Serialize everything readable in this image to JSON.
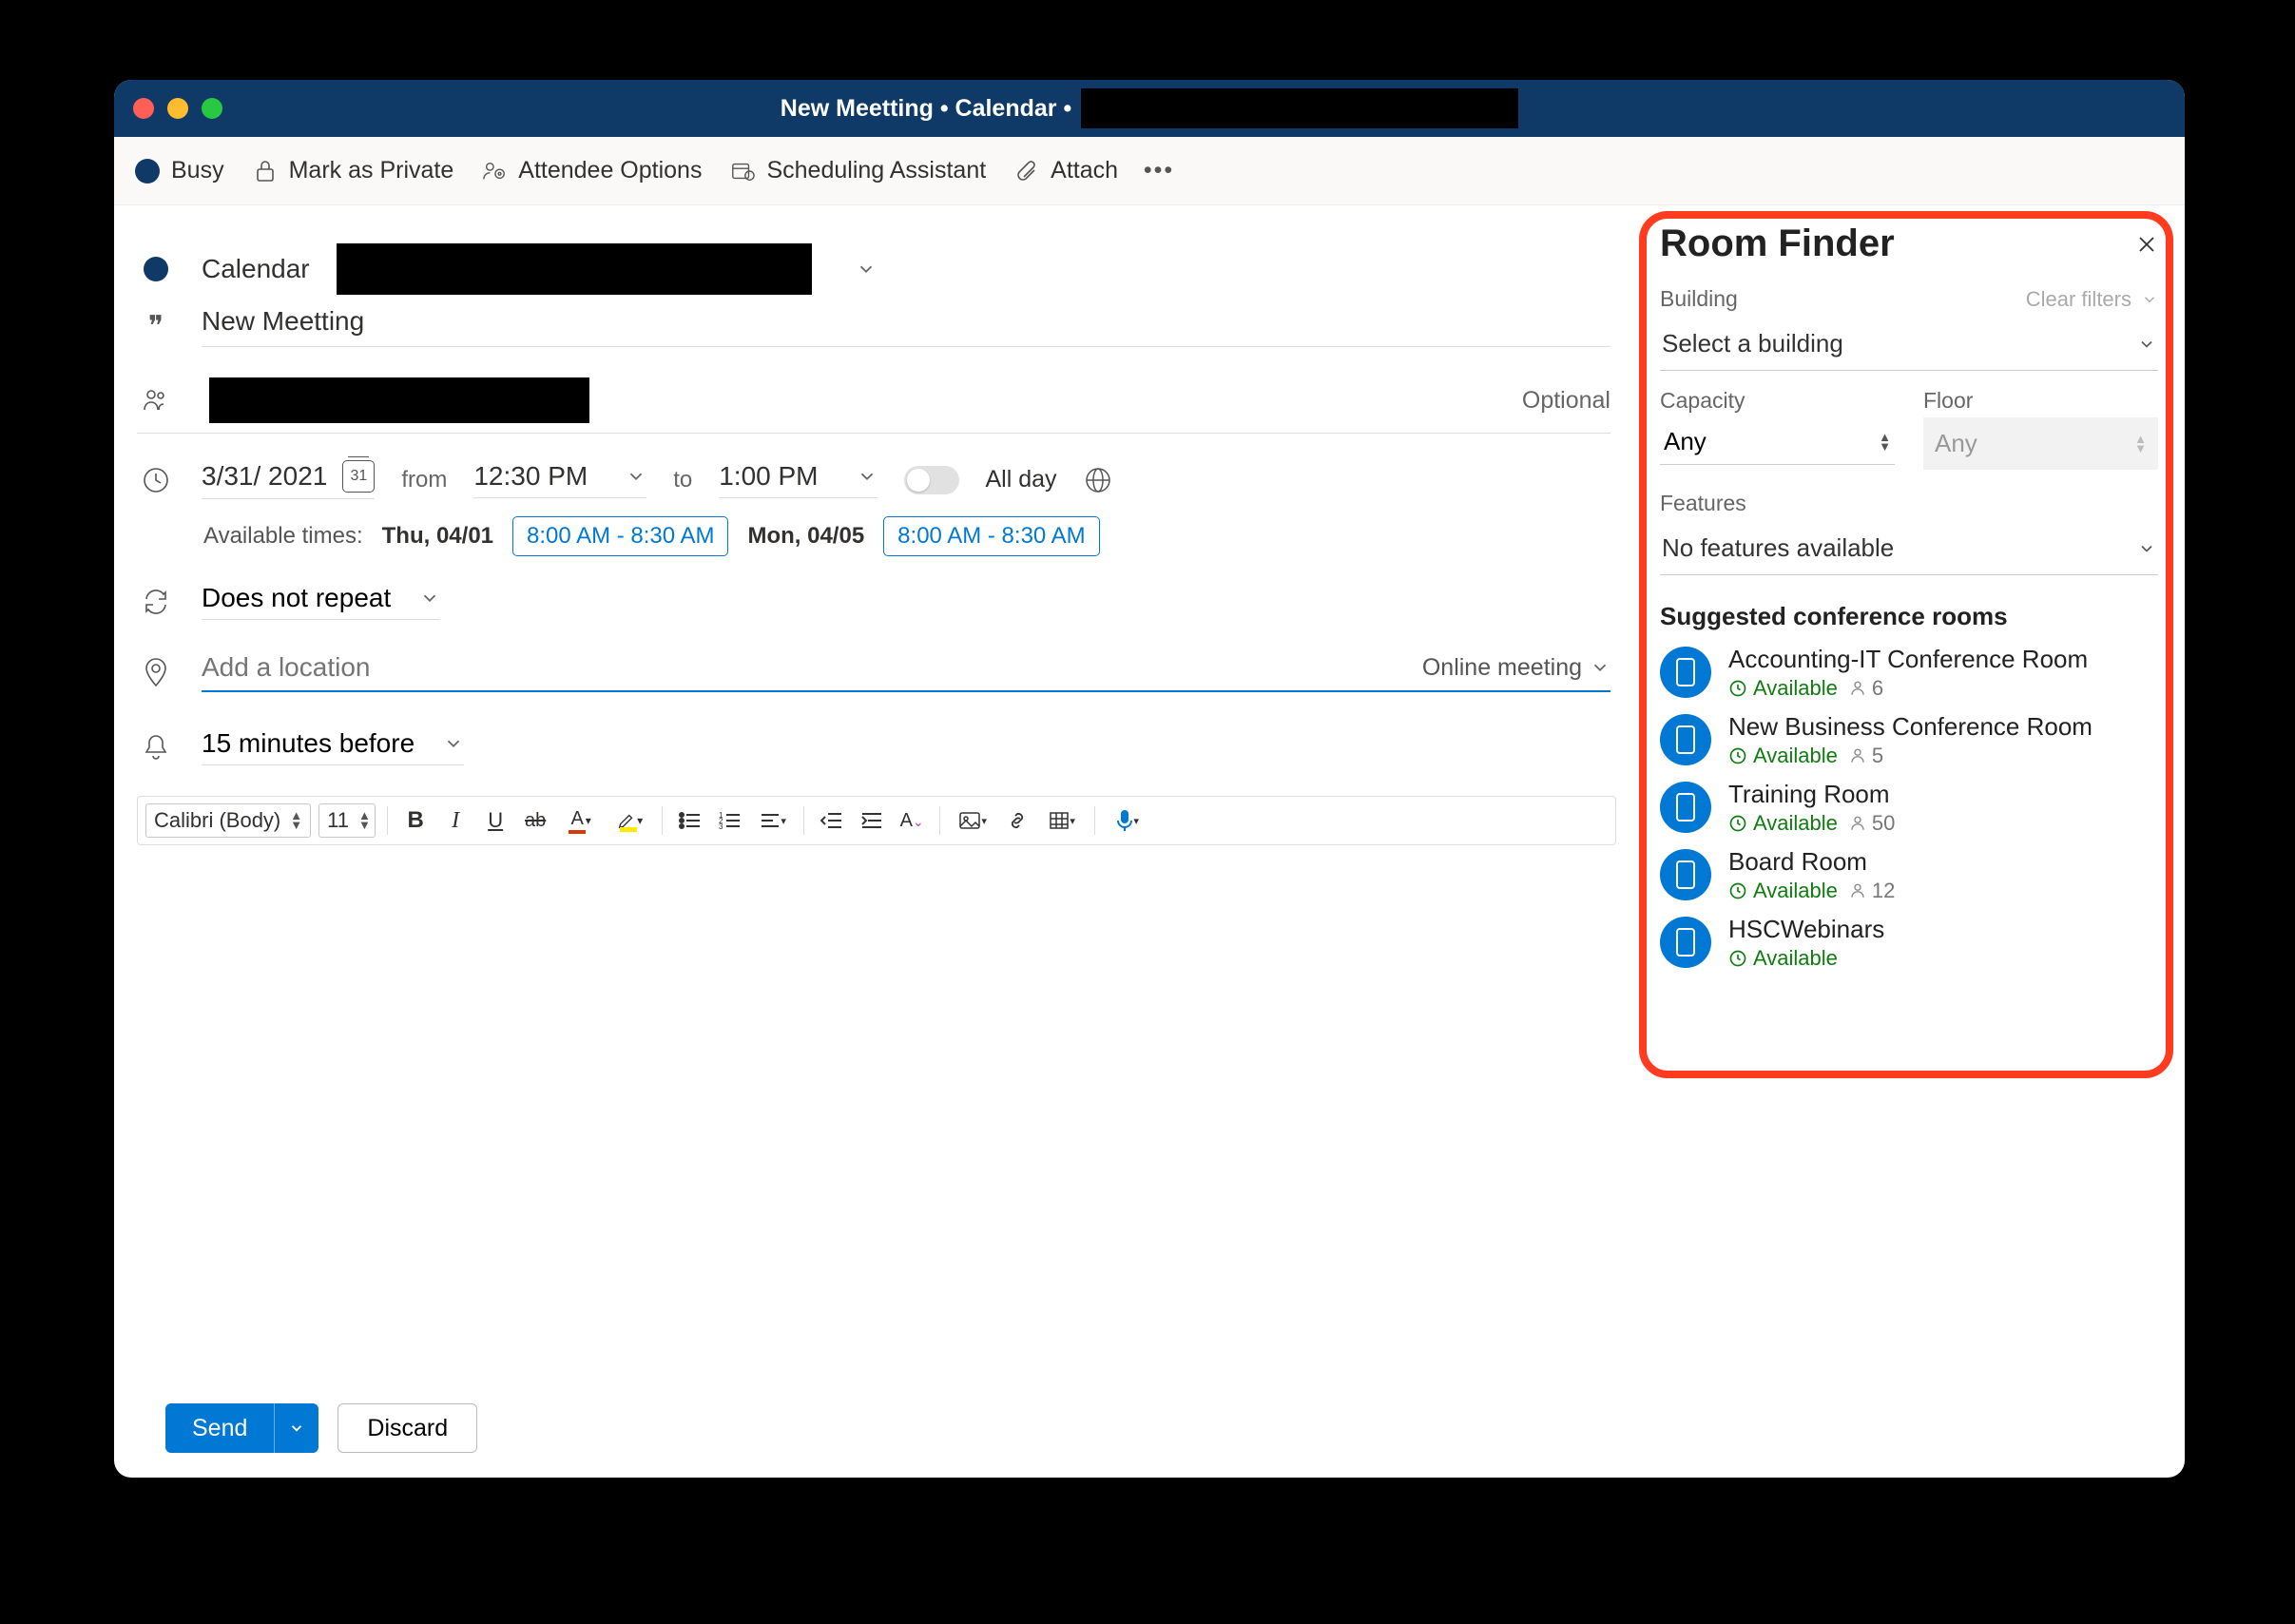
{
  "window": {
    "title_prefix": "New Meetting • Calendar •"
  },
  "ribbon": {
    "busy": "Busy",
    "private": "Mark as Private",
    "attendee_options": "Attendee Options",
    "scheduling_assistant": "Scheduling Assistant",
    "attach": "Attach"
  },
  "form": {
    "calendar_label": "Calendar",
    "title_value": "New Meetting",
    "optional_label": "Optional",
    "date": "3/31/ 2021",
    "from_label": "from",
    "start_time": "12:30 PM",
    "to_label": "to",
    "end_time": "1:00 PM",
    "all_day_label": "All day",
    "available_label": "Available times:",
    "avail_1_day": "Thu, 04/01",
    "avail_1_slot": "8:00 AM - 8:30 AM",
    "avail_2_day": "Mon, 04/05",
    "avail_2_slot": "8:00 AM - 8:30 AM",
    "repeat": "Does not repeat",
    "location_placeholder": "Add a location",
    "online_meeting": "Online meeting",
    "reminder": "15 minutes before"
  },
  "editor": {
    "font_name": "Calibri (Body)",
    "font_size": "11"
  },
  "footer": {
    "send": "Send",
    "discard": "Discard"
  },
  "roomfinder": {
    "title": "Room Finder",
    "building_label": "Building",
    "clear_filters": "Clear filters",
    "building_select": "Select a building",
    "capacity_label": "Capacity",
    "capacity_value": "Any",
    "floor_label": "Floor",
    "floor_value": "Any",
    "features_label": "Features",
    "features_value": "No features available",
    "suggested_label": "Suggested conference rooms",
    "available_text": "Available",
    "rooms": [
      {
        "name": "Accounting-IT Conference Room",
        "capacity": "6"
      },
      {
        "name": "New Business Conference Room",
        "capacity": "5"
      },
      {
        "name": "Training Room",
        "capacity": "50"
      },
      {
        "name": "Board Room",
        "capacity": "12"
      },
      {
        "name": "HSCWebinars",
        "capacity": ""
      }
    ]
  }
}
